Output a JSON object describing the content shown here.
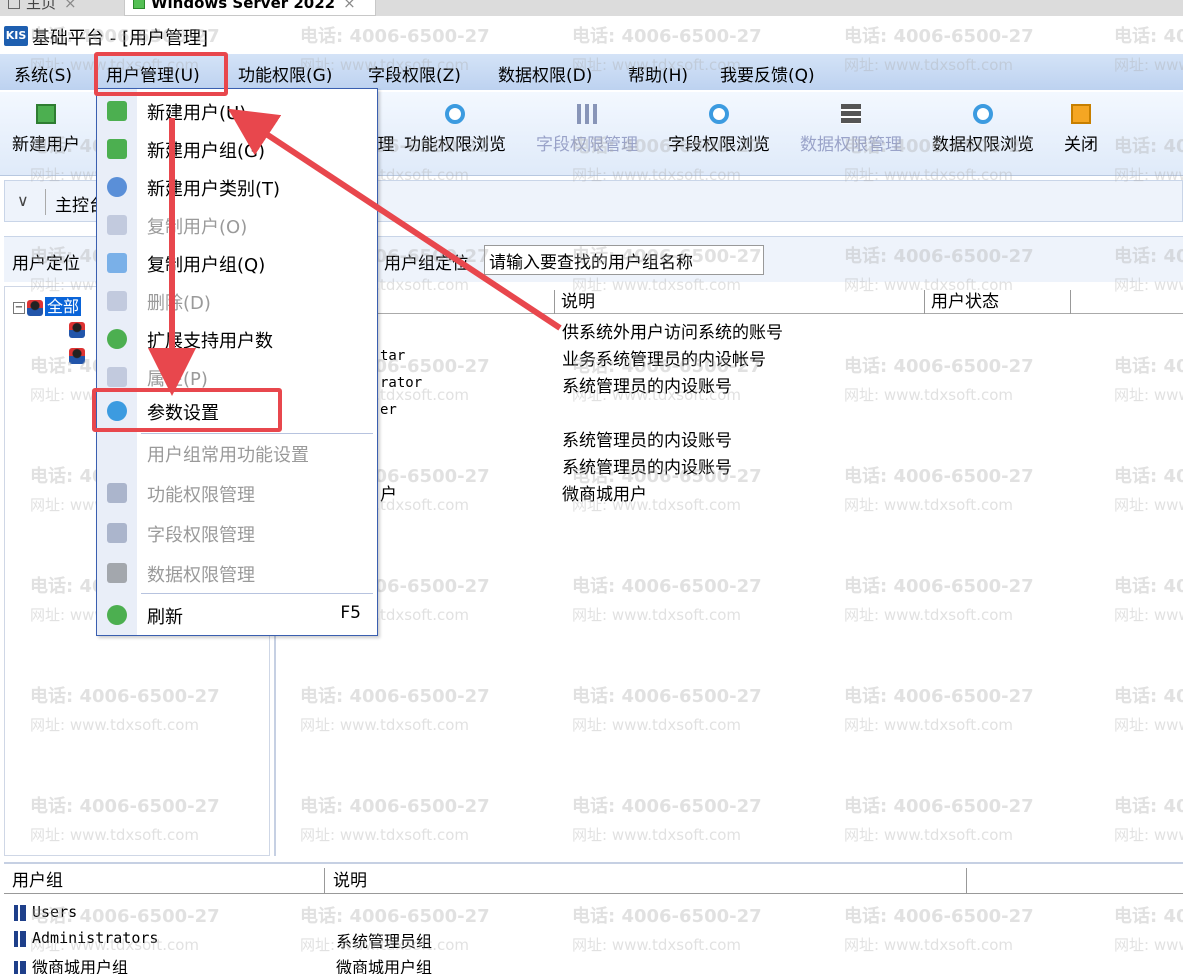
{
  "host_tabs": [
    {
      "label": "主页",
      "close": "×"
    },
    {
      "label": "Windows Server 2022",
      "close": "×"
    }
  ],
  "window": {
    "logo": "KIS",
    "title": "基础平台 - [用户管理]"
  },
  "menubar": [
    "系统(S)",
    "用户管理(U)",
    "功能权限(G)",
    "字段权限(Z)",
    "数据权限(D)",
    "帮助(H)",
    "我要反馈(Q)"
  ],
  "toolbar": [
    {
      "label": "新建用户",
      "icon": "new-icon",
      "enabled": true
    },
    {
      "label": "理",
      "icon": "user-icon",
      "enabled": true
    },
    {
      "label": "功能权限浏览",
      "icon": "view-icon",
      "enabled": true
    },
    {
      "label": "字段权限管理",
      "icon": "bars-icon",
      "enabled": false
    },
    {
      "label": "字段权限浏览",
      "icon": "view-icon",
      "enabled": true
    },
    {
      "label": "数据权限管理",
      "icon": "database-icon",
      "enabled": false
    },
    {
      "label": "数据权限浏览",
      "icon": "view-icon",
      "enabled": true
    },
    {
      "label": "关闭",
      "icon": "door-icon",
      "enabled": true
    }
  ],
  "nav": {
    "chevron": "∨",
    "label": "主控台"
  },
  "locate": {
    "user_label": "用户定位",
    "group_label": "用户组定位",
    "group_input": "请输入要查找的用户组名称"
  },
  "tree": {
    "root_label": "全部",
    "expander": "−"
  },
  "list": {
    "columns": [
      "",
      "说明",
      "用户状态"
    ],
    "rows": [
      {
        "name": "",
        "desc": "供系统外用户访问系统的账号"
      },
      {
        "name": "tar",
        "desc": "业务系统管理员的内设帐号"
      },
      {
        "name": "rator",
        "desc": "系统管理员的内设账号"
      },
      {
        "name": "er",
        "desc": ""
      },
      {
        "name": "",
        "desc": "系统管理员的内设账号"
      },
      {
        "name": "",
        "desc": "系统管理员的内设账号"
      },
      {
        "name": "户",
        "desc": "微商城用户"
      }
    ]
  },
  "groups": {
    "columns": [
      "用户组",
      "说明"
    ],
    "rows": [
      {
        "name": "Users",
        "desc": ""
      },
      {
        "name": "Administrators",
        "desc": "系统管理员组"
      },
      {
        "name": "微商城用户组",
        "desc": "微商城用户组"
      }
    ]
  },
  "dropdown": {
    "items": [
      {
        "label": "新建用户(U)",
        "enabled": true,
        "icon": "new-user-icon"
      },
      {
        "label": "新建用户组(G)",
        "enabled": true,
        "icon": "new-group-icon"
      },
      {
        "label": "新建用户类别(T)",
        "enabled": true,
        "icon": "user-category-icon"
      },
      {
        "label": "复制用户(O)",
        "enabled": false,
        "icon": "copy-icon"
      },
      {
        "label": "复制用户组(Q)",
        "enabled": true,
        "icon": "copy-group-icon"
      },
      {
        "label": "删除(D)",
        "enabled": false,
        "icon": "trash-icon"
      },
      {
        "label": "扩展支持用户数",
        "enabled": true,
        "icon": "plus-circle-icon"
      },
      {
        "label": "属性(P)",
        "enabled": false,
        "icon": "properties-icon"
      },
      {
        "label": "参数设置",
        "enabled": true,
        "icon": "gear-icon"
      },
      {
        "label": "用户组常用功能设置",
        "enabled": false,
        "icon": ""
      },
      {
        "label": "功能权限管理",
        "enabled": false,
        "icon": "org-icon"
      },
      {
        "label": "字段权限管理",
        "enabled": false,
        "icon": "bars-icon"
      },
      {
        "label": "数据权限管理",
        "enabled": false,
        "icon": "database-icon"
      },
      {
        "label": "刷新",
        "enabled": true,
        "icon": "refresh-icon",
        "shortcut": "F5"
      }
    ]
  },
  "watermark": {
    "phone": "电话: 4006-6500-27",
    "url": "网址: www.tdxsoft.com"
  },
  "colors": {
    "annotation": "#e8474d",
    "menubar": "#c9dbf3",
    "selection": "#0a64d8"
  }
}
